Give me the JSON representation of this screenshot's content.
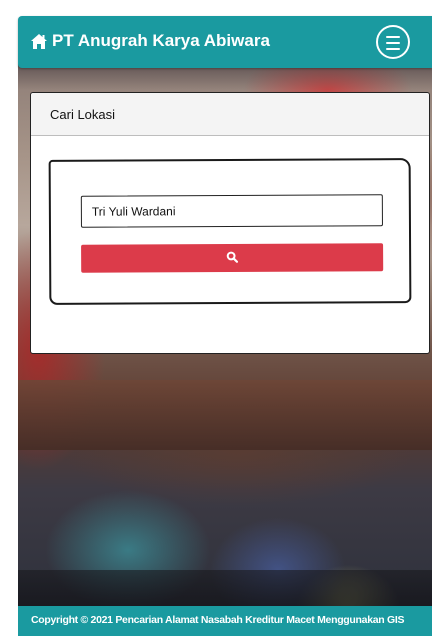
{
  "navbar": {
    "brand": "PT Anugrah Karya Abiwara",
    "brand_icon": "home-icon",
    "menu_icon": "hamburger-menu-icon",
    "color": "#1a9aa0"
  },
  "search_card": {
    "title": "Cari Lokasi",
    "input_value": "Tri Yuli Wardani",
    "button_icon": "search-icon",
    "button_color": "#dc3b4a"
  },
  "footer": {
    "text": "Copyright © 2021 Pencarian Alamat Nasabah Kreditur Macet Menggunakan GIS"
  }
}
